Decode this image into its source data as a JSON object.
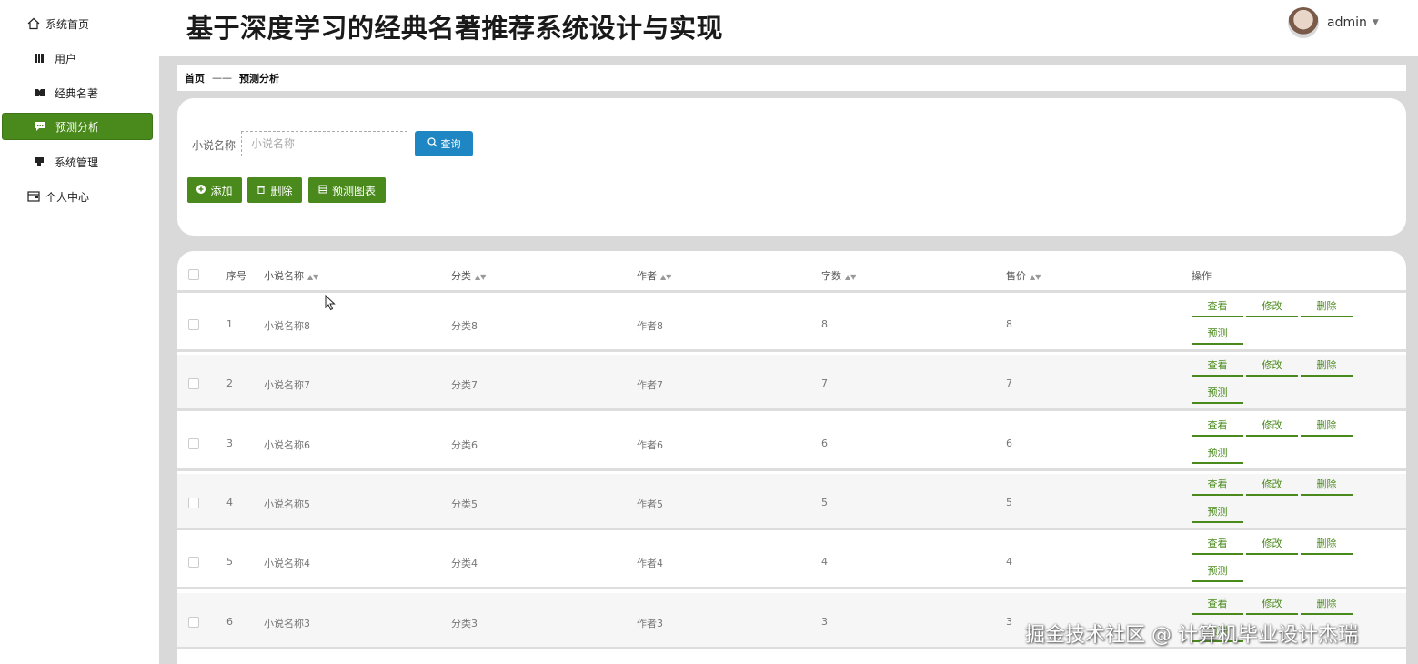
{
  "header": {
    "title": "基于深度学习的经典名著推荐系统设计与实现",
    "username": "admin"
  },
  "sidebar": {
    "items": [
      {
        "label": "系统首页",
        "icon": "home-icon"
      },
      {
        "label": "用户",
        "icon": "user-icon"
      },
      {
        "label": "经典名著",
        "icon": "book-icon"
      },
      {
        "label": "预测分析",
        "icon": "chat-icon",
        "active": true
      },
      {
        "label": "系统管理",
        "icon": "settings-icon"
      },
      {
        "label": "个人中心",
        "icon": "wallet-icon"
      }
    ]
  },
  "breadcrumb": {
    "home": "首页",
    "separator": "——",
    "current": "预测分析"
  },
  "search": {
    "label": "小说名称",
    "placeholder": "小说名称",
    "button": "查询"
  },
  "toolbar": {
    "add": "添加",
    "delete": "删除",
    "chart": "预测图表"
  },
  "table": {
    "headers": {
      "index": "序号",
      "name": "小说名称",
      "category": "分类",
      "author": "作者",
      "words": "字数",
      "price": "售价",
      "actions": "操作"
    },
    "actions": {
      "view": "查看",
      "edit": "修改",
      "delete": "删除",
      "predict": "预测"
    },
    "rows": [
      {
        "index": "1",
        "name": "小说名称8",
        "category": "分类8",
        "author": "作者8",
        "words": "8",
        "price": "8"
      },
      {
        "index": "2",
        "name": "小说名称7",
        "category": "分类7",
        "author": "作者7",
        "words": "7",
        "price": "7"
      },
      {
        "index": "3",
        "name": "小说名称6",
        "category": "分类6",
        "author": "作者6",
        "words": "6",
        "price": "6"
      },
      {
        "index": "4",
        "name": "小说名称5",
        "category": "分类5",
        "author": "作者5",
        "words": "5",
        "price": "5"
      },
      {
        "index": "5",
        "name": "小说名称4",
        "category": "分类4",
        "author": "作者4",
        "words": "4",
        "price": "4"
      },
      {
        "index": "6",
        "name": "小说名称3",
        "category": "分类3",
        "author": "作者3",
        "words": "3",
        "price": "3"
      }
    ]
  },
  "watermark": "掘金技术社区 @ 计算机毕业设计杰瑞",
  "colors": {
    "accent": "#4a8a1c",
    "search_button": "#1f86c4",
    "content_bg": "#d9d9d9"
  }
}
